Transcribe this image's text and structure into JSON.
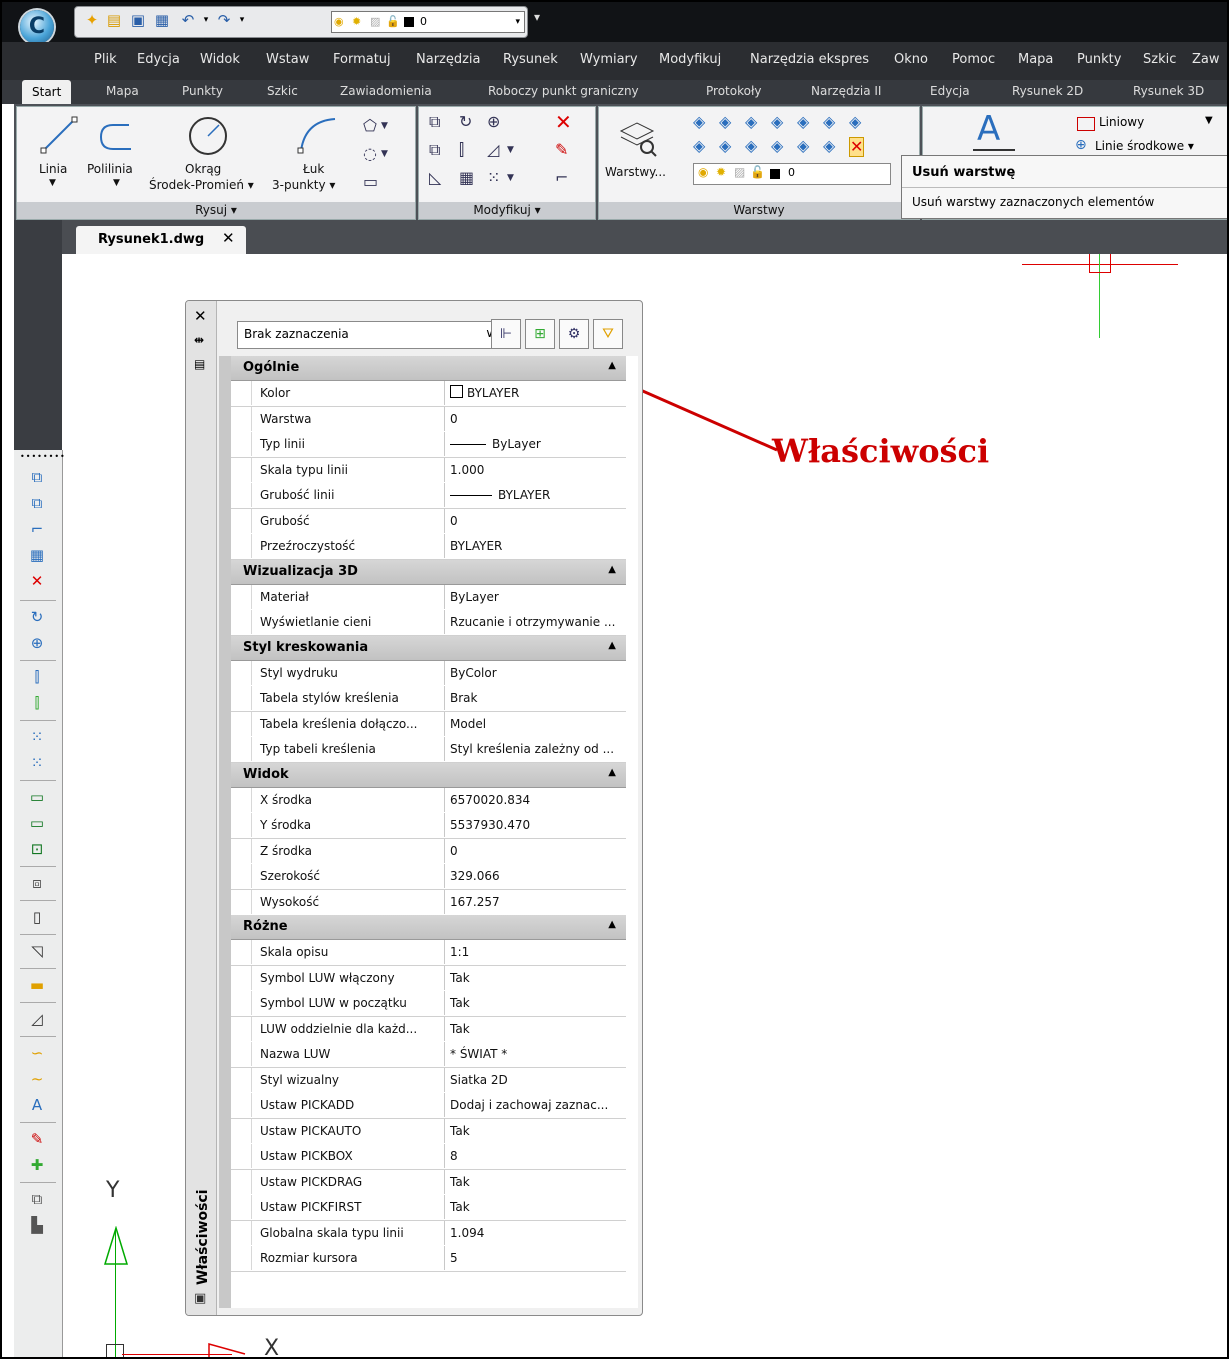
{
  "title_bar": {
    "qat_layer_value": "0",
    "qat_more": "▾"
  },
  "menu": [
    "Plik",
    "Edycja",
    "Widok",
    "Wstaw",
    "Formatuj",
    "Narzędzia",
    "Rysunek",
    "Wymiary",
    "Modyfikuj",
    "Narzędzia ekspres",
    "Okno",
    "Pomoc",
    "Mapa",
    "Punkty",
    "Szkic",
    "Zaw"
  ],
  "ribbon_tabs": [
    "Start",
    "Mapa",
    "Punkty",
    "Szkic",
    "Zawiadomienia",
    "Roboczy punkt graniczny",
    "Protokoły",
    "Narzędzia II",
    "Edycja",
    "Rysunek 2D",
    "Rysunek 3D"
  ],
  "ribbon": {
    "draw": {
      "linia": "Linia",
      "polilinia": "Polilinia",
      "okrag_1": "Okrąg",
      "okrag_2": "Środek-Promień ▾",
      "luk_1": "Łuk",
      "luk_2": "3-punkty ▾",
      "footer": "Rysuj ▾"
    },
    "modify": {
      "footer": "Modyfikuj ▾"
    },
    "layers": {
      "warstwy_button": "Warstwy...",
      "layer_value": "0",
      "footer": "Warstwy"
    },
    "annot": {
      "linetype": "Liniowy",
      "centerlines": "Linie środkowe ▾"
    }
  },
  "tooltip": {
    "title": "Usuń warstwę",
    "description": "Usuń warstwy zaznaczonych elementów"
  },
  "document_tab": {
    "name": "Rysunek1.dwg",
    "close": "✕"
  },
  "palette": {
    "vertical_title": "Właściwości",
    "selection": "Brak zaznaczenia",
    "sections": [
      {
        "title": "Ogólnie",
        "rows": [
          [
            "Kolor",
            "BYLAYER"
          ],
          [
            "Warstwa",
            "0"
          ],
          [
            "Typ linii",
            "ByLayer"
          ],
          [
            "Skala typu linii",
            "1.000"
          ],
          [
            "Grubość linii",
            "BYLAYER"
          ],
          [
            "Grubość",
            "0"
          ],
          [
            "Przeźroczystość",
            "BYLAYER"
          ]
        ]
      },
      {
        "title": "Wizualizacja 3D",
        "rows": [
          [
            "Materiał",
            "ByLayer"
          ],
          [
            "Wyświetlanie cieni",
            "Rzucanie i otrzymywanie ..."
          ]
        ]
      },
      {
        "title": "Styl kreskowania",
        "rows": [
          [
            "Styl wydruku",
            "ByColor"
          ],
          [
            "Tabela stylów kreślenia",
            "Brak"
          ],
          [
            "Tabela kreślenia dołączo...",
            "Model"
          ],
          [
            "Typ tabeli kreślenia",
            "Styl kreślenia zależny od ..."
          ]
        ]
      },
      {
        "title": "Widok",
        "rows": [
          [
            "X środka",
            "6570020.834"
          ],
          [
            "Y środka",
            "5537930.470"
          ],
          [
            "Z środka",
            "0"
          ],
          [
            "Szerokość",
            "329.066"
          ],
          [
            "Wysokość",
            "167.257"
          ]
        ]
      },
      {
        "title": "Różne",
        "rows": [
          [
            "Skala opisu",
            "1:1"
          ],
          [
            "Symbol LUW włączony",
            "Tak"
          ],
          [
            "Symbol LUW w początku",
            "Tak"
          ],
          [
            "LUW oddzielnie dla każd...",
            "Tak"
          ],
          [
            "Nazwa LUW",
            "* ŚWIAT *"
          ],
          [
            "Styl wizualny",
            "Siatka 2D"
          ],
          [
            "Ustaw PICKADD",
            "Dodaj i zachowaj zaznac..."
          ],
          [
            "Ustaw PICKAUTO",
            "Tak"
          ],
          [
            "Ustaw PICKBOX",
            "8"
          ],
          [
            "Ustaw PICKDRAG",
            "Tak"
          ],
          [
            "Ustaw PICKFIRST",
            "Tak"
          ],
          [
            "Globalna skala typu linii",
            "1.094"
          ],
          [
            "Rozmiar kursora",
            "5"
          ]
        ]
      }
    ]
  },
  "annotation": "Właściwości",
  "ucs": {
    "y_label": "Y",
    "x_label": "X"
  },
  "colors": {
    "annotation_red": "#cc0000",
    "ucs_green": "#00aa00"
  }
}
